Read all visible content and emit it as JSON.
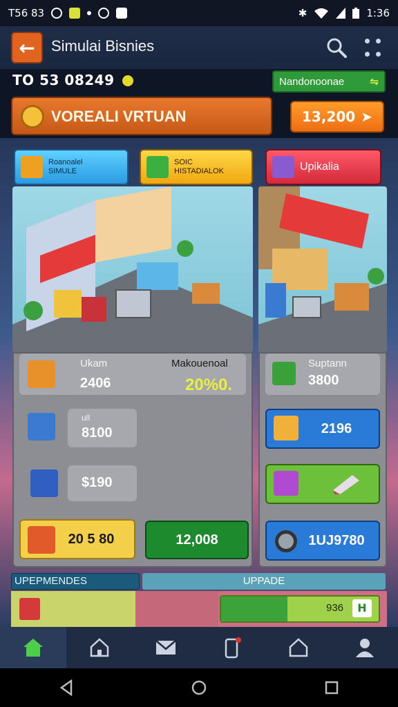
{
  "status_bar": {
    "time_left": "T56 83",
    "clock": "1:36"
  },
  "header": {
    "title": "Simulai Bisnies",
    "back_icon": "arrow-left-icon",
    "search_icon": "search-icon",
    "menu_icon": "dots-menu-icon"
  },
  "currency": {
    "prefix": "TO",
    "amount": "53 08249"
  },
  "green_pill": {
    "label": "Nandonoonae"
  },
  "banner": {
    "title": "VOREALI VRTUAN",
    "button_value": "13,200"
  },
  "tabs": [
    {
      "label_top": "Roanoalel",
      "label_bottom": "SIMULE"
    },
    {
      "label_top": "SOIC",
      "label_bottom": "HISTADIALOK"
    },
    {
      "label": "Upikalia"
    }
  ],
  "left_stats": {
    "row1_label": "Ukam",
    "row1_value": "2406",
    "row1_right_label": "Makouenoal",
    "row1_right_value": "20%0.",
    "row2_label": "ull",
    "row2_value": "8100",
    "row3_value": "$190",
    "btn_yellow": "20 5 80",
    "btn_green": "12,008"
  },
  "right_stats": {
    "row1_label": "Suptann",
    "row1_value": "3800",
    "row2_value": "2196",
    "row4_value": "1UJ9780"
  },
  "sections": {
    "left_label": "UPEPMENDES",
    "right_label": "UPPADE",
    "progress_value": "936",
    "progress_fraction": 0.42
  },
  "colors": {
    "accent_orange": "#e0631f",
    "accent_green": "#2f9a3a",
    "accent_blue": "#1f6fd0",
    "accent_red": "#d42a3a",
    "accent_yellow": "#f0c23a"
  }
}
